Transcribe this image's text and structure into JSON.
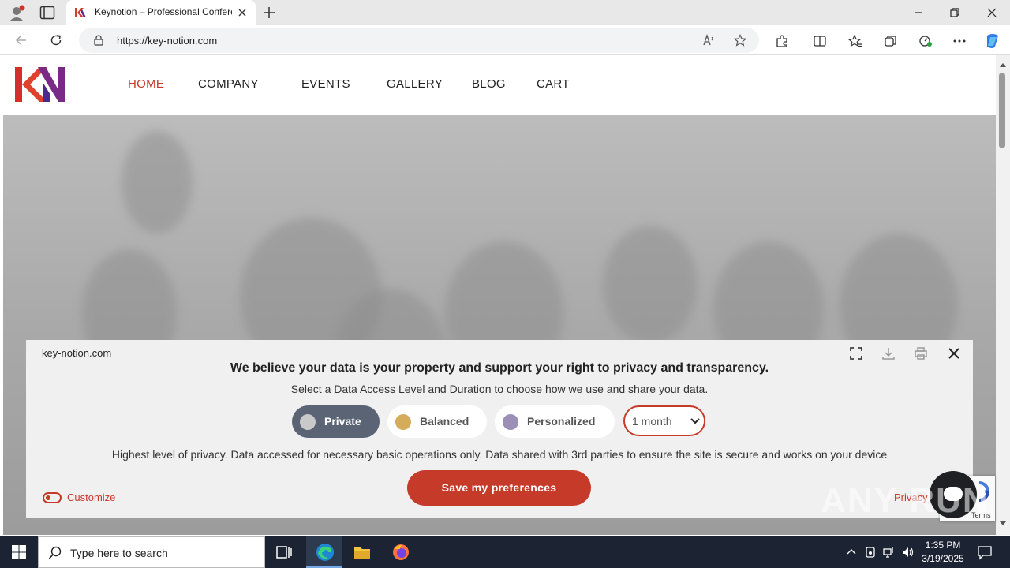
{
  "browser": {
    "tab_title": "Keynotion – Professional Confere",
    "url": "https://key-notion.com"
  },
  "site": {
    "nav": [
      "HOME",
      "COMPANY",
      "EVENTS",
      "GALLERY",
      "BLOG",
      "CART"
    ],
    "active_nav": "HOME",
    "accent_color": "#c63a2a"
  },
  "consent": {
    "site_name": "key-notion.com",
    "heading": "We believe your data is your property and support your right to privacy and transparency.",
    "subheading": "Select a Data Access Level and Duration to choose how we use and share your data.",
    "levels": [
      {
        "label": "Private",
        "color": "#c9c9c9",
        "selected": true
      },
      {
        "label": "Balanced",
        "color": "#d4ac5c",
        "selected": false
      },
      {
        "label": "Personalized",
        "color": "#9b8fb8",
        "selected": false
      }
    ],
    "duration": "1 month",
    "description": "Highest level of privacy. Data accessed for necessary basic operations only. Data shared with 3rd parties to ensure the site is secure and works on your device",
    "save_label": "Save my preferences",
    "customize_label": "Customize",
    "privacy_label": "Privacy"
  },
  "recaptcha": {
    "terms": "Terms"
  },
  "watermark": "ANY RUN",
  "taskbar": {
    "search_placeholder": "Type here to search",
    "time": "1:35 PM",
    "date": "3/19/2025"
  }
}
